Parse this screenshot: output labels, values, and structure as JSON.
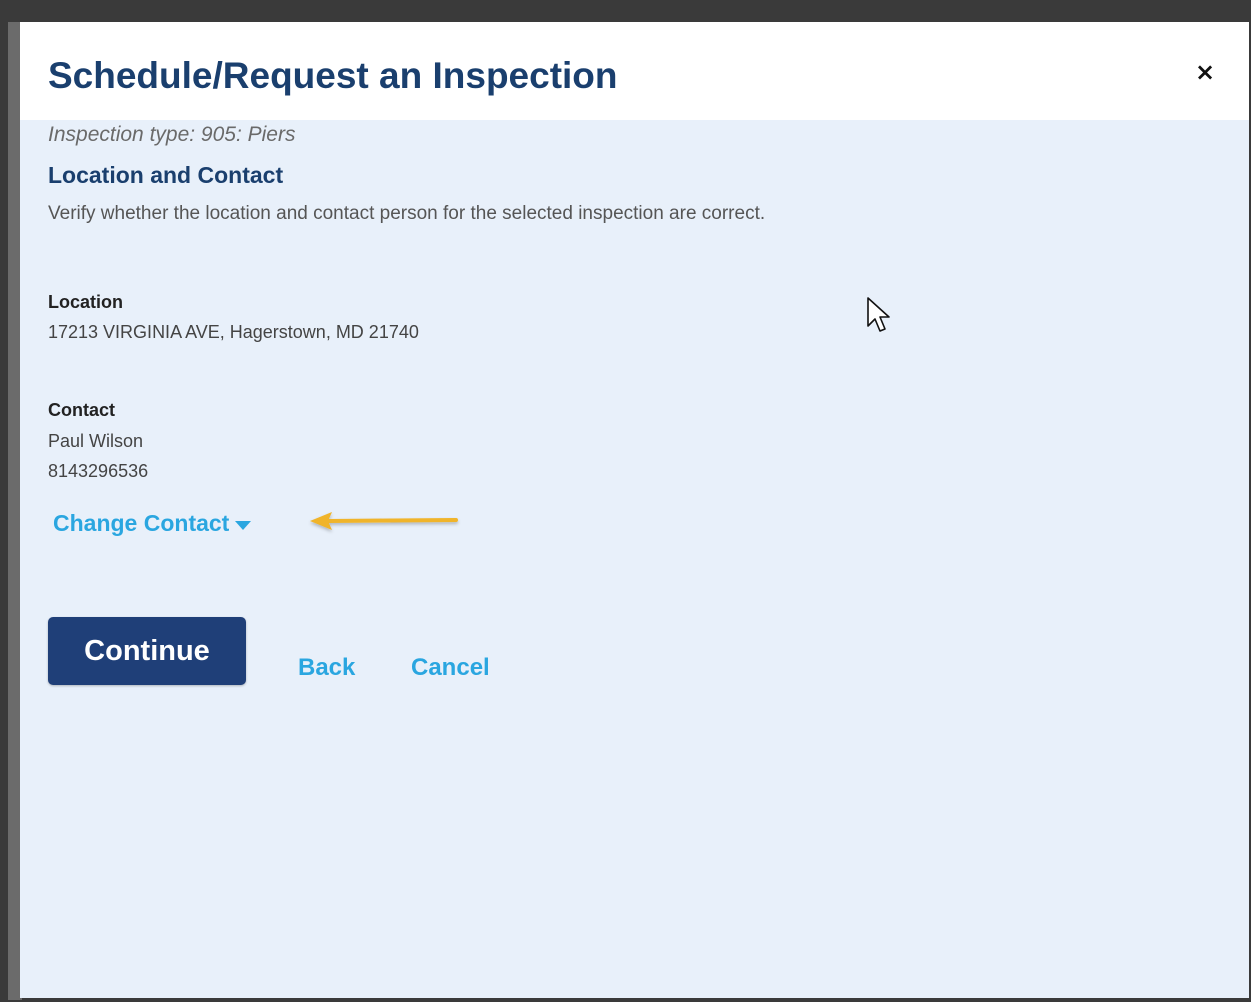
{
  "modal": {
    "title": "Schedule/Request an Inspection",
    "close_label": "×"
  },
  "inspection": {
    "type_text": "Inspection type: 905: Piers"
  },
  "section": {
    "title": "Location and Contact",
    "description": "Verify whether the location and contact person for the selected inspection are correct."
  },
  "location": {
    "label": "Location",
    "address": "17213 VIRGINIA AVE, Hagerstown, MD 21740"
  },
  "contact": {
    "label": "Contact",
    "name": "Paul Wilson",
    "phone": "8143296536",
    "change_label": "Change Contact"
  },
  "actions": {
    "continue_label": "Continue",
    "back_label": "Back",
    "cancel_label": "Cancel"
  },
  "colors": {
    "title": "#1a3f6e",
    "link": "#2aa6e0",
    "primary_button": "#1f3f78",
    "panel_background": "#e8f0fa",
    "annotation_arrow": "#f0b429"
  },
  "icons": {
    "close": "close-icon",
    "caret": "caret-down-icon",
    "annotation": "arrow-left-annotation-icon",
    "cursor": "mouse-pointer-icon"
  }
}
